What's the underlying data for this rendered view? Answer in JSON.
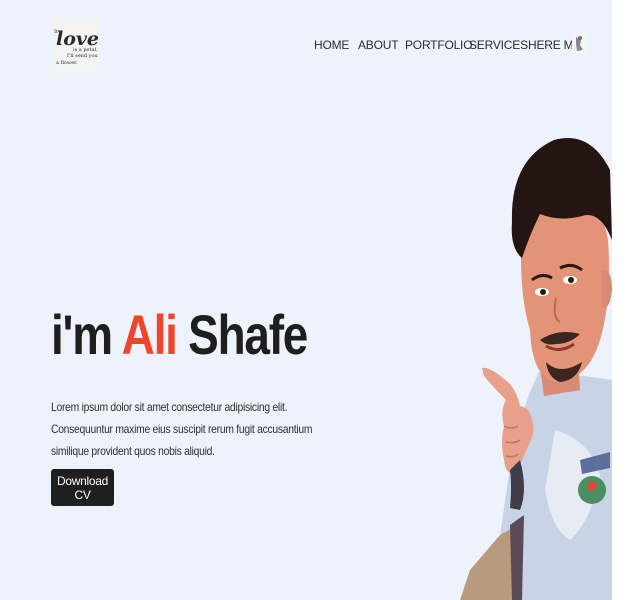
{
  "logo": {
    "line1": "It",
    "word": "love",
    "line2": "is a petal,",
    "line3": "I'll send you",
    "line4": "a flower."
  },
  "nav": {
    "items": [
      "HOME",
      "ABOUT",
      "PORTFOLIO",
      "SERVICES",
      "HERE ME"
    ]
  },
  "hero": {
    "greeting": "i'm",
    "first_name": "Ali",
    "last_name": "Shafe",
    "description": "Lorem ipsum dolor sit amet consectetur adipisicing elit. Consequuntur maxime eius suscipit rerum fugit accusantium similique provident quos nobis aliquid.",
    "button_label": "Download CV"
  },
  "colors": {
    "background": "#eef2fd",
    "accent": "#f0452b",
    "button": "#1f1f1f",
    "text": "#1e1e1e"
  },
  "icons": {
    "nav_extra": "user-icon"
  }
}
